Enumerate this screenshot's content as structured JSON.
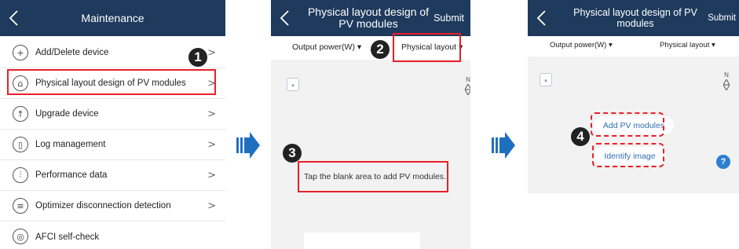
{
  "screen1": {
    "title": "Maintenance",
    "menu": [
      {
        "label": "Add/Delete device",
        "icon": "plus-circle-icon",
        "glyph": "+"
      },
      {
        "label": "Physical layout design of PV modules",
        "icon": "layout-design-icon",
        "glyph": "⌂"
      },
      {
        "label": "Upgrade device",
        "icon": "upgrade-arrow-icon",
        "glyph": "↑"
      },
      {
        "label": "Log management",
        "icon": "log-icon",
        "glyph": "▯"
      },
      {
        "label": "Performance data",
        "icon": "performance-icon",
        "glyph": "⫶"
      },
      {
        "label": "Optimizer disconnection detection",
        "icon": "optimizer-detect-icon",
        "glyph": "≡"
      },
      {
        "label": "AFCI self-check",
        "icon": "afci-icon",
        "glyph": "◎"
      }
    ],
    "chevron": ">"
  },
  "screen2": {
    "title": "Physical layout design of PV modules",
    "submit": "Submit",
    "filter_left": "Output power(W) ▾",
    "filter_right": "Physical layout ▾",
    "compass_n": "N",
    "hint": "Tap the blank area to add PV modules."
  },
  "screen3": {
    "title": "Physical layout design of PV modules",
    "submit": "Submit",
    "filter_left": "Output power(W) ▾",
    "filter_right": "Physical layout ▾",
    "compass_n": "N",
    "add_pv": "Add PV modules",
    "identify": "Identify image",
    "help": "?"
  },
  "steps": {
    "one": "1",
    "two": "2",
    "three": "3",
    "four": "4"
  },
  "colors": {
    "navbar": "#1e3a5c",
    "highlight": "#e8202a",
    "arrow": "#1f6fc0",
    "link": "#2f6fb0"
  }
}
